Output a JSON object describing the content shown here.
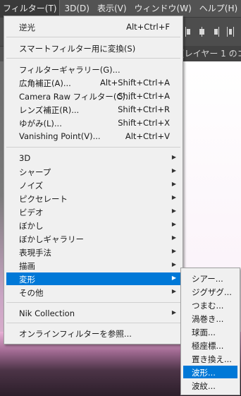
{
  "menubar": {
    "items": [
      {
        "label": "フィルター(T)",
        "active": true
      },
      {
        "label": "3D(D)"
      },
      {
        "label": "表示(V)"
      },
      {
        "label": "ウィンドウ(W)"
      },
      {
        "label": "ヘルプ(H)"
      }
    ]
  },
  "document": {
    "tab_label": "(レイヤー 1 のコ"
  },
  "filter_menu": {
    "last_filter": {
      "label": "逆光",
      "shortcut": "Alt+Ctrl+F"
    },
    "smart_filter": {
      "label": "スマートフィルター用に変換(S)"
    },
    "gallery": {
      "label": "フィルターギャラリー(G)..."
    },
    "adaptive_wide": {
      "label": "広角補正(A)...",
      "shortcut": "Alt+Shift+Ctrl+A"
    },
    "camera_raw": {
      "label": "Camera Raw フィルター(C)...",
      "shortcut": "Shift+Ctrl+A"
    },
    "lens_correction": {
      "label": "レンズ補正(R)...",
      "shortcut": "Shift+Ctrl+R"
    },
    "liquify": {
      "label": "ゆがみ(L)...",
      "shortcut": "Shift+Ctrl+X"
    },
    "vanishing_point": {
      "label": "Vanishing Point(V)...",
      "shortcut": "Alt+Ctrl+V"
    },
    "submenus": [
      {
        "label": "3D"
      },
      {
        "label": "シャープ"
      },
      {
        "label": "ノイズ"
      },
      {
        "label": "ピクセレート"
      },
      {
        "label": "ビデオ"
      },
      {
        "label": "ぼかし"
      },
      {
        "label": "ぼかしギャラリー"
      },
      {
        "label": "表現手法"
      },
      {
        "label": "描画"
      },
      {
        "label": "変形",
        "highlighted": true
      },
      {
        "label": "その他"
      }
    ],
    "nik": {
      "label": "Nik Collection"
    },
    "browse_online": {
      "label": "オンラインフィルターを参照..."
    }
  },
  "distort_submenu": {
    "items": [
      {
        "label": "シアー..."
      },
      {
        "label": "ジグザグ..."
      },
      {
        "label": "つまむ..."
      },
      {
        "label": "渦巻き..."
      },
      {
        "label": "球面..."
      },
      {
        "label": "極座標..."
      },
      {
        "label": "置き換え..."
      },
      {
        "label": "波形...",
        "highlighted": true
      },
      {
        "label": "波紋..."
      }
    ]
  },
  "colors": {
    "highlight": "#0078d7",
    "menu_bg": "#f0f0f0",
    "app_bg": "#535353"
  },
  "icons": {
    "submenu_arrow": "triangle-right-icon",
    "align": "align-distribute-icons"
  }
}
